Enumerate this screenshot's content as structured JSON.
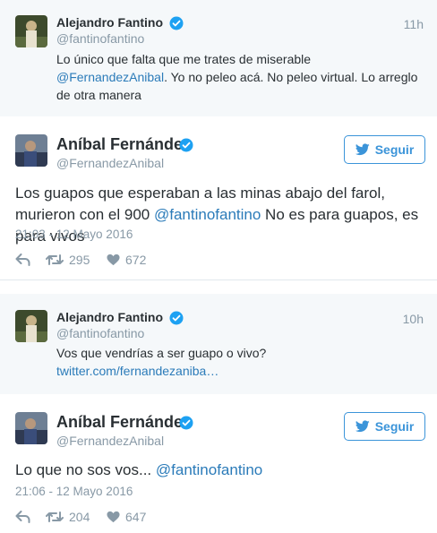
{
  "tweets": [
    {
      "type": "reply",
      "author": {
        "name": "Alejandro Fantino",
        "handle": "@fantinofantino"
      },
      "time": "11h",
      "text_plain_1": "Lo único que falta que me trates de miserable",
      "mention": "@FernandezAnibal",
      "text_plain_2": ". Yo no peleo acá. No peleo virtual. Lo arreglo de otra manera"
    },
    {
      "type": "main",
      "author": {
        "name": "Aníbal Fernández",
        "handle": "@FernandezAnibal"
      },
      "follow_label": "Seguir",
      "text_plain": "Los guapos que esperaban a las minas abajo del farol, murieron con el 900 ",
      "mention": "@fantinofantino",
      "text_plain_2": " No es para guapos, es para vivos",
      "date": "21:03 - 12 Mayo 2016",
      "retweets": "295",
      "likes": "672"
    },
    {
      "type": "reply",
      "author": {
        "name": "Alejandro Fantino",
        "handle": "@fantinofantino"
      },
      "time": "10h",
      "text_plain": "Vos que vendrías a ser guapo o vivo?",
      "link": "twitter.com/fernandezaniba…"
    },
    {
      "type": "main",
      "author": {
        "name": "Aníbal Fernández",
        "handle": "@FernandezAnibal"
      },
      "follow_label": "Seguir",
      "text_plain": "Lo que no sos vos... ",
      "mention": "@fantinofantino",
      "date": "21:06 - 12 Mayo 2016",
      "retweets": "204",
      "likes": "647"
    }
  ],
  "colors": {
    "link": "#2b7bb9",
    "verified": "#1da1f2",
    "follow": "#3b94d9",
    "muted": "#8899a6"
  },
  "icons": [
    "verified-icon",
    "twitter-bird-icon",
    "reply-icon",
    "retweet-icon",
    "heart-icon"
  ]
}
